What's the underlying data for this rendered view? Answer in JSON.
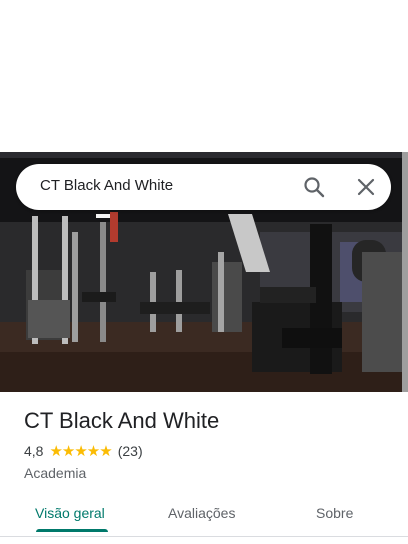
{
  "search": {
    "query": "CT Black And White"
  },
  "place": {
    "name": "CT Black And White",
    "rating": "4,8",
    "stars": "★★★★★",
    "review_count": "(23)",
    "category": "Academia"
  },
  "tabs": [
    {
      "label": "Visão geral",
      "active": true
    },
    {
      "label": "Avaliações",
      "active": false
    },
    {
      "label": "Sobre",
      "active": false
    }
  ],
  "colors": {
    "accent": "#00796b",
    "star": "#fbbc04"
  },
  "icons": {
    "search": "search-icon",
    "close": "close-icon"
  }
}
